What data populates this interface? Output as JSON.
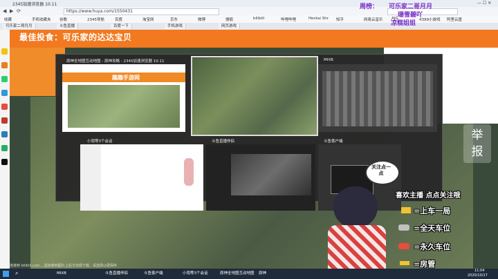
{
  "browser": {
    "window_title": "2345加速浏览器 10.11",
    "url": "https://www.huya.com/1550431",
    "favorites": [
      "收藏",
      "手机收藏夹",
      "谷歌",
      "2345导航",
      "百度",
      "淘宝网",
      "京东",
      "微博",
      "搜狐",
      "bilibili",
      "哔哩哔哩",
      "Hentai Shr",
      "知乎",
      "网易云音乐",
      "AIG",
      "4399小游戏",
      "阿里云盘"
    ],
    "tabs": [
      "可乐家二哥月月",
      "斗鱼直播",
      "百度一下",
      "手机游戏",
      "网页游戏"
    ]
  },
  "stream": {
    "title": "最佳投食：可乐家的达达宝贝",
    "rank_label": "周榜：",
    "rank_names": [
      "可乐家二哥月月",
      "珊雪碧吖",
      "凉糕姐姐"
    ],
    "report": "举报"
  },
  "switcher": {
    "windows": [
      {
        "title": "原神全地图互动地图 - 原神攻略 - 2345加速浏览器 10.11",
        "site": "趣趣手游网"
      },
      {
        "title": "原神",
        "site": ""
      },
      {
        "title": "MIXB",
        "site": ""
      },
      {
        "title": "小雨等3个会话",
        "site": ""
      },
      {
        "title": "斗鱼直播伴侣",
        "site": ""
      },
      {
        "title": "斗鱼客户端",
        "site": ""
      }
    ]
  },
  "overlay": {
    "bubble": "关注点一点",
    "promo_title": "喜欢主播 点点关注哦",
    "promo_items": [
      "=上车一局",
      "=全天车位",
      "=永久车位",
      "=房管"
    ]
  },
  "status": {
    "text": "连接到 bilibili.com... 鼠标移到图片上后才出现下载，请选择以便保存"
  },
  "taskbar": {
    "items": [
      "MIXB",
      "斗鱼直播伴侣",
      "斗鱼客户端",
      "小雨等3个会话",
      "原神全地图互动地图",
      "原神"
    ],
    "time": "11:04",
    "date": "2020/10/17"
  }
}
